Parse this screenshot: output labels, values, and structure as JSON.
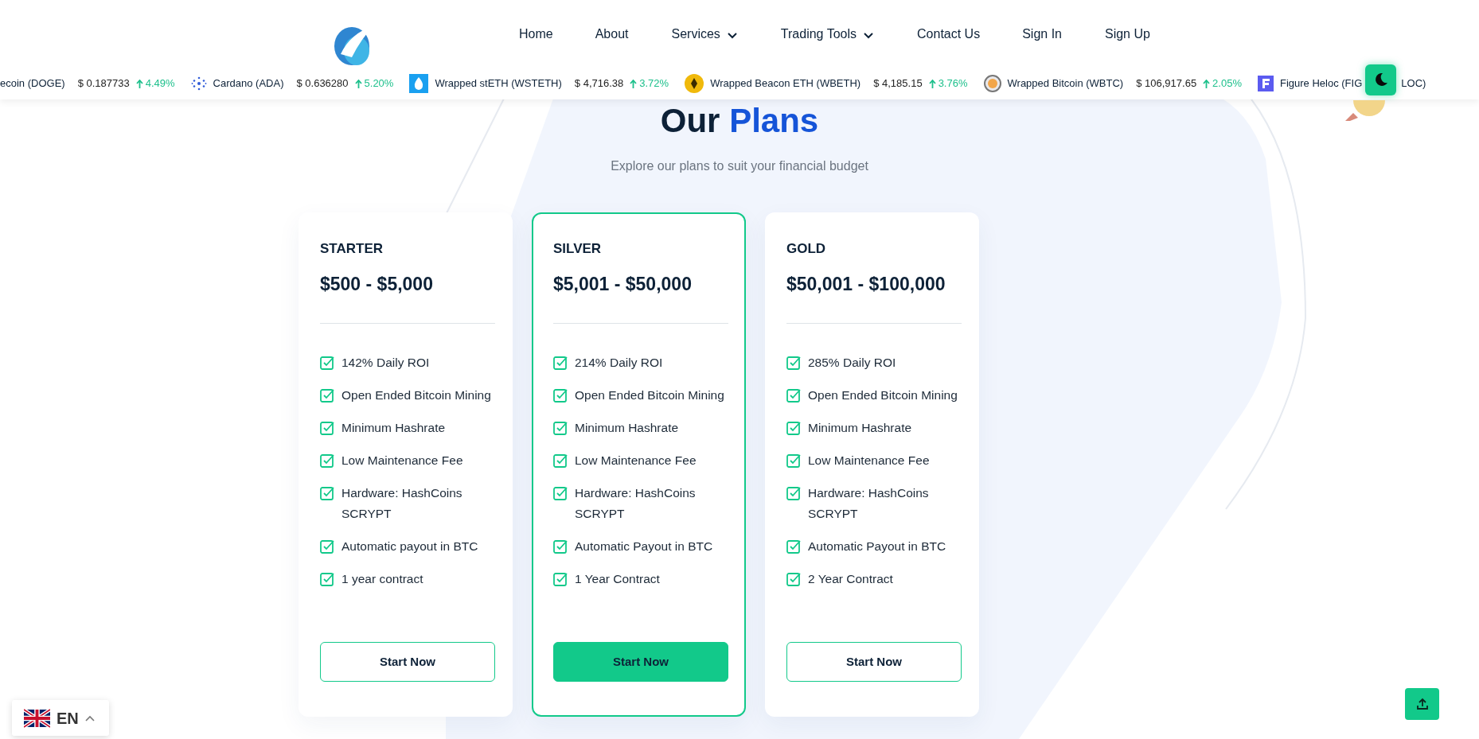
{
  "nav": {
    "items": [
      {
        "label": "Home",
        "dropdown": false
      },
      {
        "label": "About",
        "dropdown": false
      },
      {
        "label": "Services",
        "dropdown": true
      },
      {
        "label": "Trading Tools",
        "dropdown": true
      },
      {
        "label": "Contact Us",
        "dropdown": false
      },
      {
        "label": "Sign In",
        "dropdown": false
      },
      {
        "label": "Sign Up",
        "dropdown": false
      }
    ]
  },
  "ticker": [
    {
      "name": "ecoin (DOGE)",
      "price": "$ 0.187733",
      "change": "4.49%"
    },
    {
      "name": "Cardano (ADA)",
      "price": "$ 0.636280",
      "change": "5.20%"
    },
    {
      "name": "Wrapped stETH (WSTETH)",
      "price": "$ 4,716.38",
      "change": "3.72%"
    },
    {
      "name": "Wrapped Beacon ETH (WBETH)",
      "price": "$ 4,185.15",
      "change": "3.76%"
    },
    {
      "name": "Wrapped Bitcoin (WBTC)",
      "price": "$ 106,917.65",
      "change": "2.05%"
    },
    {
      "name": "Figure Heloc (FIG",
      "name_rest": "LOC)"
    }
  ],
  "heading": {
    "text": "Our",
    "accent": "Plans"
  },
  "subtitle": "Explore our plans to suit your financial budget",
  "plans": [
    {
      "name": "STARTER",
      "price": "$500 - $5,000",
      "selected": false,
      "features": [
        "142% Daily ROI",
        "Open Ended Bitcoin Mining",
        "Minimum Hashrate",
        "Low Maintenance Fee",
        "Hardware: HashCoins SCRYPT",
        "Automatic payout in BTC",
        "1 year contract"
      ],
      "button": "Start Now"
    },
    {
      "name": "SILVER",
      "price": "$5,001 - $50,000",
      "selected": true,
      "features": [
        "214% Daily ROI",
        "Open Ended Bitcoin Mining",
        "Minimum Hashrate",
        "Low Maintenance Fee",
        "Hardware: HashCoins SCRYPT",
        "Automatic Payout in BTC",
        "1 Year Contract"
      ],
      "button": "Start Now"
    },
    {
      "name": "GOLD",
      "price": "$50,001 - $100,000",
      "selected": false,
      "features": [
        "285% Daily ROI",
        "Open Ended Bitcoin Mining",
        "Minimum Hashrate",
        "Low Maintenance Fee",
        "Hardware: HashCoins SCRYPT",
        "Automatic Payout in BTC",
        "2 Year Contract"
      ],
      "button": "Start Now"
    }
  ],
  "language": {
    "code": "EN"
  }
}
